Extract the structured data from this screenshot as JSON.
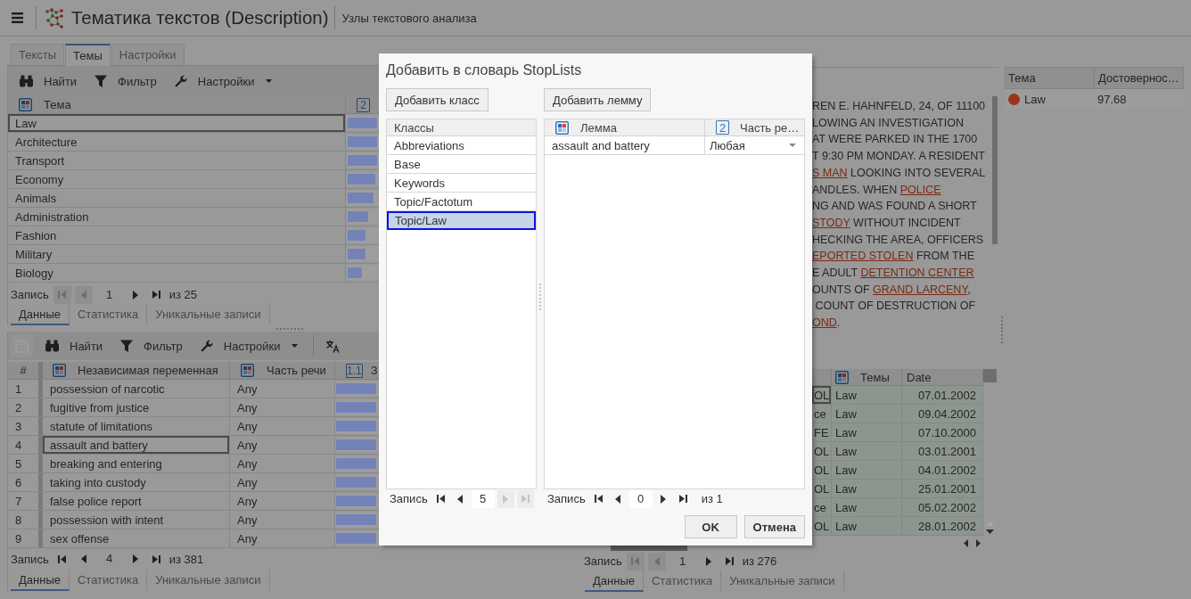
{
  "header": {
    "title": "Тематика текстов (Description)",
    "subtitle": "Узлы текстового анализа"
  },
  "topics_panel": {
    "tabs": [
      {
        "label": "Тексты",
        "selected": false
      },
      {
        "label": "Темы",
        "selected": true
      },
      {
        "label": "Настройки",
        "selected": false
      }
    ],
    "toolbar": [
      {
        "kind": "find",
        "label": "Найти",
        "disabled": false
      },
      {
        "kind": "filter",
        "label": "Фильтр",
        "disabled": false
      },
      {
        "kind": "settings",
        "label": "Настройки",
        "disabled": false
      }
    ],
    "columns": [
      {
        "kind": "category",
        "label": "Тема"
      },
      {
        "kind": "number",
        "badge": "2"
      }
    ],
    "rows": [
      {
        "topic": "Law",
        "level": 1,
        "focused": true
      },
      {
        "topic": "Architecture",
        "level": 1,
        "focused": false
      },
      {
        "topic": "Transport",
        "level": 1,
        "focused": false
      },
      {
        "topic": "Economy",
        "level": 0.94,
        "focused": false
      },
      {
        "topic": "Animals",
        "level": 0.89,
        "focused": false
      },
      {
        "topic": "Administration",
        "level": 0.69,
        "focused": false
      },
      {
        "topic": "Fashion",
        "level": 0.6,
        "focused": false
      },
      {
        "topic": "Military",
        "level": 0.6,
        "focused": false
      },
      {
        "topic": "Biology",
        "level": 0.49,
        "focused": false
      }
    ],
    "pager": {
      "label": "Запись",
      "value": "1",
      "total": "из 25",
      "buttons": [
        {
          "kind": "first",
          "disabled": true
        },
        {
          "kind": "prev",
          "disabled": true
        },
        {
          "kind": "next",
          "disabled": false
        },
        {
          "kind": "last",
          "disabled": false
        }
      ]
    },
    "view_tabs": [
      {
        "label": "Данные",
        "selected": true
      },
      {
        "label": "Статистика",
        "selected": false
      },
      {
        "label": "Уникальные записи",
        "selected": false
      }
    ]
  },
  "variables_panel": {
    "toolbar": [
      {
        "kind": "save",
        "disabled": true
      },
      {
        "kind": "find",
        "label": "Найти",
        "disabled": false
      },
      {
        "kind": "filter",
        "label": "Фильтр",
        "disabled": false
      },
      {
        "kind": "settings",
        "label": "Настройки",
        "disabled": false
      },
      {
        "kind": "translate",
        "disabled": false
      }
    ],
    "columns": [
      {
        "kind": "index",
        "label": "#"
      },
      {
        "kind": "category",
        "label": "Независимая переменная"
      },
      {
        "kind": "category",
        "label": "Часть речи"
      },
      {
        "kind": "number",
        "badge": "1.1",
        "label": "З"
      }
    ],
    "rows": [
      {
        "index": "1",
        "term": "possession of narcotic",
        "part_of_speech": "Any",
        "level": 1,
        "focused": false
      },
      {
        "index": "2",
        "term": "fugitive from justice",
        "part_of_speech": "Any",
        "level": 1,
        "focused": false
      },
      {
        "index": "3",
        "term": "statute of limitations",
        "part_of_speech": "Any",
        "level": 1,
        "focused": false
      },
      {
        "index": "4",
        "term": "assault and battery",
        "part_of_speech": "Any",
        "level": 1,
        "focused": true
      },
      {
        "index": "5",
        "term": "breaking and entering",
        "part_of_speech": "Any",
        "level": 1,
        "focused": false
      },
      {
        "index": "6",
        "term": "taking into custody",
        "part_of_speech": "Any",
        "level": 1,
        "focused": false
      },
      {
        "index": "7",
        "term": "false police report",
        "part_of_speech": "Any",
        "level": 1,
        "focused": false
      },
      {
        "index": "8",
        "term": "possession with intent",
        "part_of_speech": "Any",
        "level": 1,
        "focused": false
      },
      {
        "index": "9",
        "term": "sex offense",
        "part_of_speech": "Any",
        "level": 1,
        "focused": false
      }
    ],
    "pager": {
      "label": "Запись",
      "value": "4",
      "total": "из 381",
      "buttons": [
        {
          "kind": "first",
          "disabled": false
        },
        {
          "kind": "prev",
          "disabled": false
        },
        {
          "kind": "next",
          "disabled": false
        },
        {
          "kind": "last",
          "disabled": false
        }
      ]
    },
    "view_tabs": [
      {
        "label": "Данные",
        "selected": true
      },
      {
        "label": "Статистика",
        "selected": false
      },
      {
        "label": "Уникальные записи",
        "selected": false
      }
    ]
  },
  "text_panel": {
    "lines": [
      [
        {
          "kind": "text",
          "text": "REN E. HAHNFELD, 24, OF 11100"
        }
      ],
      [
        {
          "kind": "text",
          "text": "LOWING AN INVESTIGATION"
        }
      ],
      [
        {
          "kind": "text",
          "text": "AT WERE PARKED IN THE 1700"
        }
      ],
      [
        {
          "kind": "text",
          "text": "T 9:30 PM MONDAY. A RESIDENT"
        }
      ],
      [
        {
          "kind": "term",
          "text": "S MAN"
        },
        {
          "kind": "text",
          "text": " LOOKING INTO SEVERAL"
        }
      ],
      [
        {
          "kind": "text",
          "text": "ANDLES. WHEN "
        },
        {
          "kind": "term",
          "text": "POLICE"
        }
      ],
      [
        {
          "kind": "text",
          "text": "NG AND WAS FOUND A SHORT"
        }
      ],
      [
        {
          "kind": "term",
          "text": "STODY"
        },
        {
          "kind": "text",
          "text": " WITHOUT INCIDENT"
        }
      ],
      [
        {
          "kind": "text",
          "text": "HECKING THE AREA, OFFICERS"
        }
      ],
      [
        {
          "kind": "term",
          "text": "EPORTED STOLEN"
        },
        {
          "kind": "text",
          "text": " FROM THE"
        }
      ],
      [
        {
          "kind": "text",
          "text": "E ADULT "
        },
        {
          "kind": "term",
          "text": "DETENTION CENTER"
        }
      ],
      [
        {
          "kind": "text",
          "text": "OUNTS OF "
        },
        {
          "kind": "term",
          "text": "GRAND LARCENY"
        },
        {
          "kind": "text",
          "text": ","
        }
      ],
      [
        {
          "kind": "text",
          "text": " COUNT OF DESTRUCTION OF"
        }
      ],
      [
        {
          "kind": "term",
          "text": "OND"
        },
        {
          "kind": "text",
          "text": "."
        }
      ]
    ]
  },
  "topic_scores": {
    "columns": [
      "Тема",
      "Достовернос…"
    ],
    "rows": [
      {
        "topic": "Law",
        "color": "#9a3517",
        "confidence": "97.68"
      }
    ]
  },
  "documents_table": {
    "columns": [
      {
        "kind": "plain"
      },
      {
        "kind": "category",
        "label": "Темы"
      },
      {
        "kind": "plain",
        "label": "Date"
      }
    ],
    "rows": [
      {
        "column_1": "OL",
        "topic": "Law",
        "date": "07.01.2002",
        "focused": true
      },
      {
        "column_1": "ce",
        "topic": "Law",
        "date": "09.04.2002",
        "focused": false
      },
      {
        "column_1": "FE",
        "topic": "Law",
        "date": "07.10.2000",
        "focused": false
      },
      {
        "column_1": "OL",
        "topic": "Law",
        "date": "03.01.2001",
        "focused": false
      },
      {
        "column_1": "OL",
        "topic": "Law",
        "date": "04.01.2002",
        "focused": false
      },
      {
        "column_1": "OL",
        "topic": "Law",
        "date": "25.01.2001",
        "focused": false
      },
      {
        "column_1": "ce",
        "topic": "Law",
        "date": "05.02.2002",
        "focused": false
      },
      {
        "column_1": "OL",
        "topic": "Law",
        "date": "28.01.2002",
        "focused": false
      }
    ],
    "pager": {
      "label": "Запись",
      "value": "1",
      "total": "из 276",
      "buttons": [
        {
          "kind": "first",
          "disabled": true
        },
        {
          "kind": "prev",
          "disabled": true
        },
        {
          "kind": "next",
          "disabled": false
        },
        {
          "kind": "last",
          "disabled": false
        }
      ]
    },
    "view_tabs": [
      {
        "label": "Данные",
        "selected": true
      },
      {
        "label": "Статистика",
        "selected": false
      },
      {
        "label": "Уникальные записи",
        "selected": false
      }
    ]
  },
  "dialog": {
    "title": "Добавить в словарь StopLists",
    "classes": {
      "button": "Добавить класс",
      "header": "Классы",
      "items": [
        {
          "label": "Abbreviations",
          "selected": false
        },
        {
          "label": "Base",
          "selected": false
        },
        {
          "label": "Keywords",
          "selected": false
        },
        {
          "label": "Topic/Factotum",
          "selected": false
        },
        {
          "label": "Topic/Law",
          "selected": true
        }
      ],
      "pager": {
        "label": "Запись",
        "value": "5",
        "buttons": [
          {
            "kind": "first",
            "disabled": false
          },
          {
            "kind": "prev",
            "disabled": false
          },
          {
            "kind": "next",
            "disabled": true
          },
          {
            "kind": "last",
            "disabled": true
          }
        ]
      }
    },
    "lemmas": {
      "button": "Добавить лемму",
      "columns": [
        {
          "kind": "category",
          "label": "Лемма"
        },
        {
          "kind": "number",
          "badge": "2",
          "label": "Часть ре…"
        }
      ],
      "rows": [
        {
          "lemma": "assault and battery",
          "part_of_speech": "Любая"
        }
      ],
      "pager": {
        "label": "Запись",
        "value": "0",
        "total": "из 1",
        "buttons": [
          {
            "kind": "first",
            "disabled": false
          },
          {
            "kind": "prev",
            "disabled": false
          },
          {
            "kind": "next",
            "disabled": false
          },
          {
            "kind": "last",
            "disabled": false
          }
        ]
      }
    },
    "buttons": [
      "OK",
      "Отмена"
    ]
  }
}
